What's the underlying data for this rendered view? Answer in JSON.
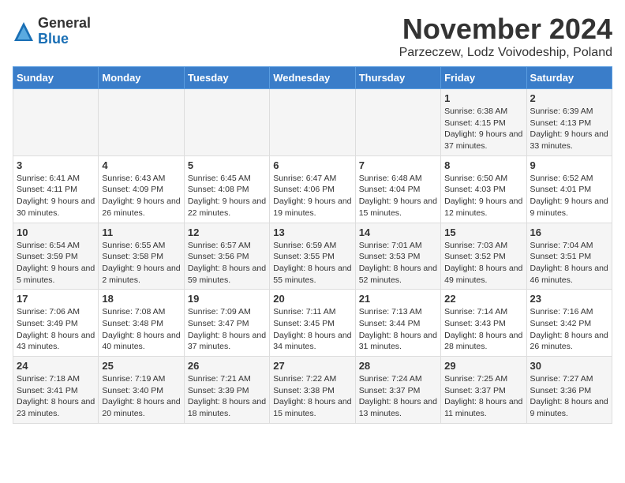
{
  "logo": {
    "general": "General",
    "blue": "Blue"
  },
  "title": "November 2024",
  "subtitle": "Parzeczew, Lodz Voivodeship, Poland",
  "days_of_week": [
    "Sunday",
    "Monday",
    "Tuesday",
    "Wednesday",
    "Thursday",
    "Friday",
    "Saturday"
  ],
  "weeks": [
    [
      {
        "day": "",
        "info": ""
      },
      {
        "day": "",
        "info": ""
      },
      {
        "day": "",
        "info": ""
      },
      {
        "day": "",
        "info": ""
      },
      {
        "day": "",
        "info": ""
      },
      {
        "day": "1",
        "info": "Sunrise: 6:38 AM\nSunset: 4:15 PM\nDaylight: 9 hours and 37 minutes."
      },
      {
        "day": "2",
        "info": "Sunrise: 6:39 AM\nSunset: 4:13 PM\nDaylight: 9 hours and 33 minutes."
      }
    ],
    [
      {
        "day": "3",
        "info": "Sunrise: 6:41 AM\nSunset: 4:11 PM\nDaylight: 9 hours and 30 minutes."
      },
      {
        "day": "4",
        "info": "Sunrise: 6:43 AM\nSunset: 4:09 PM\nDaylight: 9 hours and 26 minutes."
      },
      {
        "day": "5",
        "info": "Sunrise: 6:45 AM\nSunset: 4:08 PM\nDaylight: 9 hours and 22 minutes."
      },
      {
        "day": "6",
        "info": "Sunrise: 6:47 AM\nSunset: 4:06 PM\nDaylight: 9 hours and 19 minutes."
      },
      {
        "day": "7",
        "info": "Sunrise: 6:48 AM\nSunset: 4:04 PM\nDaylight: 9 hours and 15 minutes."
      },
      {
        "day": "8",
        "info": "Sunrise: 6:50 AM\nSunset: 4:03 PM\nDaylight: 9 hours and 12 minutes."
      },
      {
        "day": "9",
        "info": "Sunrise: 6:52 AM\nSunset: 4:01 PM\nDaylight: 9 hours and 9 minutes."
      }
    ],
    [
      {
        "day": "10",
        "info": "Sunrise: 6:54 AM\nSunset: 3:59 PM\nDaylight: 9 hours and 5 minutes."
      },
      {
        "day": "11",
        "info": "Sunrise: 6:55 AM\nSunset: 3:58 PM\nDaylight: 9 hours and 2 minutes."
      },
      {
        "day": "12",
        "info": "Sunrise: 6:57 AM\nSunset: 3:56 PM\nDaylight: 8 hours and 59 minutes."
      },
      {
        "day": "13",
        "info": "Sunrise: 6:59 AM\nSunset: 3:55 PM\nDaylight: 8 hours and 55 minutes."
      },
      {
        "day": "14",
        "info": "Sunrise: 7:01 AM\nSunset: 3:53 PM\nDaylight: 8 hours and 52 minutes."
      },
      {
        "day": "15",
        "info": "Sunrise: 7:03 AM\nSunset: 3:52 PM\nDaylight: 8 hours and 49 minutes."
      },
      {
        "day": "16",
        "info": "Sunrise: 7:04 AM\nSunset: 3:51 PM\nDaylight: 8 hours and 46 minutes."
      }
    ],
    [
      {
        "day": "17",
        "info": "Sunrise: 7:06 AM\nSunset: 3:49 PM\nDaylight: 8 hours and 43 minutes."
      },
      {
        "day": "18",
        "info": "Sunrise: 7:08 AM\nSunset: 3:48 PM\nDaylight: 8 hours and 40 minutes."
      },
      {
        "day": "19",
        "info": "Sunrise: 7:09 AM\nSunset: 3:47 PM\nDaylight: 8 hours and 37 minutes."
      },
      {
        "day": "20",
        "info": "Sunrise: 7:11 AM\nSunset: 3:45 PM\nDaylight: 8 hours and 34 minutes."
      },
      {
        "day": "21",
        "info": "Sunrise: 7:13 AM\nSunset: 3:44 PM\nDaylight: 8 hours and 31 minutes."
      },
      {
        "day": "22",
        "info": "Sunrise: 7:14 AM\nSunset: 3:43 PM\nDaylight: 8 hours and 28 minutes."
      },
      {
        "day": "23",
        "info": "Sunrise: 7:16 AM\nSunset: 3:42 PM\nDaylight: 8 hours and 26 minutes."
      }
    ],
    [
      {
        "day": "24",
        "info": "Sunrise: 7:18 AM\nSunset: 3:41 PM\nDaylight: 8 hours and 23 minutes."
      },
      {
        "day": "25",
        "info": "Sunrise: 7:19 AM\nSunset: 3:40 PM\nDaylight: 8 hours and 20 minutes."
      },
      {
        "day": "26",
        "info": "Sunrise: 7:21 AM\nSunset: 3:39 PM\nDaylight: 8 hours and 18 minutes."
      },
      {
        "day": "27",
        "info": "Sunrise: 7:22 AM\nSunset: 3:38 PM\nDaylight: 8 hours and 15 minutes."
      },
      {
        "day": "28",
        "info": "Sunrise: 7:24 AM\nSunset: 3:37 PM\nDaylight: 8 hours and 13 minutes."
      },
      {
        "day": "29",
        "info": "Sunrise: 7:25 AM\nSunset: 3:37 PM\nDaylight: 8 hours and 11 minutes."
      },
      {
        "day": "30",
        "info": "Sunrise: 7:27 AM\nSunset: 3:36 PM\nDaylight: 8 hours and 9 minutes."
      }
    ]
  ]
}
